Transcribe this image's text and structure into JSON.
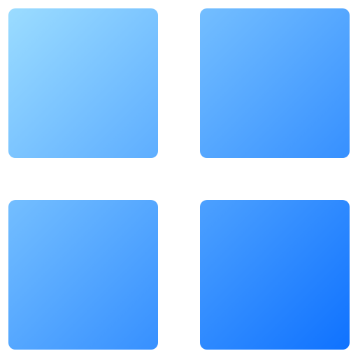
{
  "logo": {
    "icon": "windows-grid-icon",
    "tiles": [
      {
        "name": "top-left-tile"
      },
      {
        "name": "top-right-tile"
      },
      {
        "name": "bottom-left-tile"
      },
      {
        "name": "bottom-right-tile"
      }
    ],
    "colors": {
      "gradient_start": "#9bdcff",
      "gradient_end": "#0f72ff",
      "background": "#ffffff"
    }
  }
}
